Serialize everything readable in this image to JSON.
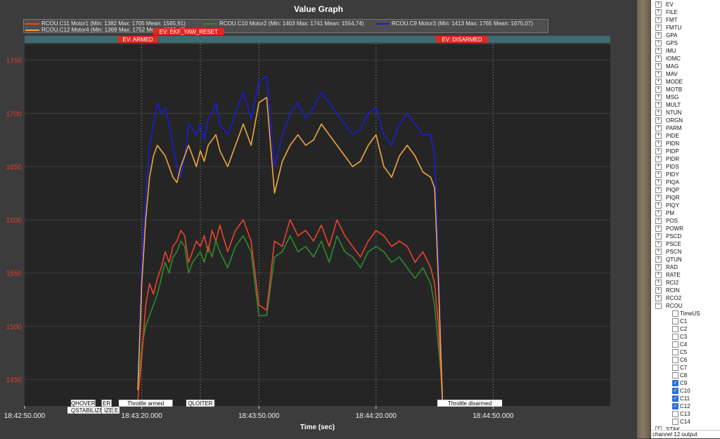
{
  "graph": {
    "title": "Value Graph",
    "xlabel": "Time (sec)"
  },
  "legend": [
    {
      "label": "RCOU.C11 Motor1 (Min: 1382 Max: 1705 Mean: 1565,91)",
      "color": "#e8452c"
    },
    {
      "label": "RCOU.C10 Motor2 (Min: 1403 Max: 1741 Mean: 1554,74)",
      "color": "#2e8b2e"
    },
    {
      "label": "RCOU.C9 Motor3 (Min: 1413 Max: 1765 Mean: 1675,07)",
      "color": "#1c1cdc"
    },
    {
      "label": "RCOU.C12 Motor4 (Min: 1369 Max: 1752 Mean: 1666,43)",
      "color": "#f0a640"
    }
  ],
  "event_labels": [
    {
      "text": "EV: ARMED",
      "t": 29
    },
    {
      "text": "EV: EKF_YAW_RESET",
      "t": 42
    },
    {
      "text": "EV: DISARMED",
      "t": 112
    }
  ],
  "mode_labels": [
    {
      "text": "QHOVER",
      "t": 15,
      "row": 0
    },
    {
      "text": "ER",
      "t": 21,
      "row": 0
    },
    {
      "text": "QSTABILIZE",
      "t": 16,
      "row": 1
    },
    {
      "text": "IZE",
      "t": 21.5,
      "row": 1
    },
    {
      "text": "E",
      "t": 23.5,
      "row": 1
    },
    {
      "text": "Throttle armed",
      "t": 31,
      "row": 0
    },
    {
      "text": "QLOITER",
      "t": 45,
      "row": 0
    },
    {
      "text": "Throttle disarmed",
      "t": 114,
      "row": 0
    }
  ],
  "colors": {
    "plot_bg": "#252525",
    "event_red": "#e0281e",
    "strip": "#3e6b72"
  },
  "chart_data": {
    "type": "line",
    "title": "Value Graph",
    "xlabel": "Time (sec)",
    "ylabel": "",
    "x_unit": "seconds since 18:42:50",
    "xlim": [
      0,
      150
    ],
    "ylim": [
      1425,
      1765
    ],
    "x_ticks": [
      {
        "t": 0,
        "label": "18:42:50.000"
      },
      {
        "t": 30,
        "label": "18:43:20.000"
      },
      {
        "t": 60,
        "label": "18:43:50.000"
      },
      {
        "t": 90,
        "label": "18:44:20.000"
      },
      {
        "t": 120,
        "label": "18:44:50.000"
      }
    ],
    "y_ticks": [
      1450,
      1500,
      1550,
      1600,
      1650,
      1700,
      1750
    ],
    "grid": true,
    "vertical_markers": [
      30,
      45,
      60,
      90,
      120
    ],
    "series": [
      {
        "name": "RCOU.C11 Motor1",
        "color": "#e8452c",
        "x": [
          29,
          30,
          31,
          32,
          33,
          34,
          35,
          36,
          37,
          38,
          39,
          40,
          41,
          42,
          43,
          44,
          45,
          46,
          47,
          48,
          49,
          50,
          52,
          54,
          56,
          58,
          60,
          62,
          64,
          66,
          68,
          70,
          72,
          74,
          76,
          78,
          80,
          82,
          84,
          86,
          88,
          90,
          92,
          94,
          96,
          98,
          100,
          102,
          104,
          105,
          106,
          107
        ],
        "y": [
          1430,
          1470,
          1520,
          1540,
          1530,
          1545,
          1555,
          1570,
          1560,
          1575,
          1580,
          1590,
          1585,
          1560,
          1570,
          1580,
          1575,
          1585,
          1570,
          1590,
          1580,
          1595,
          1570,
          1590,
          1600,
          1580,
          1520,
          1515,
          1580,
          1575,
          1600,
          1585,
          1590,
          1580,
          1595,
          1575,
          1600,
          1585,
          1575,
          1565,
          1580,
          1590,
          1585,
          1575,
          1580,
          1575,
          1560,
          1570,
          1555,
          1540,
          1500,
          1430
        ]
      },
      {
        "name": "RCOU.C10 Motor2",
        "color": "#2e8b2e",
        "x": [
          29,
          30,
          31,
          32,
          33,
          34,
          35,
          36,
          37,
          38,
          39,
          40,
          41,
          42,
          43,
          44,
          45,
          46,
          47,
          48,
          49,
          50,
          52,
          54,
          56,
          58,
          60,
          62,
          64,
          66,
          68,
          70,
          72,
          74,
          76,
          78,
          80,
          82,
          84,
          86,
          88,
          90,
          92,
          94,
          96,
          98,
          100,
          102,
          104,
          105,
          106,
          107
        ],
        "y": [
          1440,
          1480,
          1500,
          1510,
          1520,
          1530,
          1545,
          1560,
          1550,
          1565,
          1570,
          1580,
          1575,
          1550,
          1560,
          1565,
          1570,
          1560,
          1575,
          1565,
          1580,
          1570,
          1555,
          1575,
          1585,
          1570,
          1510,
          1510,
          1565,
          1570,
          1585,
          1570,
          1575,
          1565,
          1580,
          1560,
          1585,
          1570,
          1565,
          1555,
          1570,
          1575,
          1570,
          1560,
          1565,
          1555,
          1545,
          1555,
          1540,
          1520,
          1480,
          1440
        ]
      },
      {
        "name": "RCOU.C9 Motor3",
        "color": "#1c1cdc",
        "x": [
          29,
          30,
          31,
          32,
          33,
          34,
          35,
          36,
          37,
          38,
          39,
          40,
          41,
          42,
          43,
          44,
          45,
          46,
          47,
          48,
          49,
          50,
          52,
          54,
          56,
          58,
          60,
          62,
          64,
          66,
          68,
          70,
          72,
          74,
          76,
          78,
          80,
          82,
          84,
          86,
          88,
          90,
          92,
          94,
          96,
          98,
          100,
          102,
          104,
          105,
          106,
          107
        ],
        "y": [
          1450,
          1560,
          1620,
          1670,
          1690,
          1710,
          1700,
          1705,
          1690,
          1670,
          1650,
          1640,
          1660,
          1690,
          1685,
          1680,
          1690,
          1675,
          1695,
          1700,
          1710,
          1690,
          1680,
          1700,
          1720,
          1695,
          1730,
          1735,
          1650,
          1680,
          1700,
          1710,
          1695,
          1705,
          1720,
          1710,
          1700,
          1690,
          1680,
          1685,
          1700,
          1705,
          1680,
          1670,
          1690,
          1700,
          1690,
          1680,
          1680,
          1660,
          1560,
          1430
        ]
      },
      {
        "name": "RCOU.C12 Motor4",
        "color": "#f0a640",
        "x": [
          29,
          30,
          31,
          32,
          33,
          34,
          35,
          36,
          37,
          38,
          39,
          40,
          41,
          42,
          43,
          44,
          45,
          46,
          47,
          48,
          49,
          50,
          52,
          54,
          56,
          58,
          60,
          62,
          64,
          66,
          68,
          70,
          72,
          74,
          76,
          78,
          80,
          82,
          84,
          86,
          88,
          90,
          92,
          94,
          96,
          98,
          100,
          102,
          104,
          105,
          106,
          107
        ],
        "y": [
          1440,
          1540,
          1600,
          1640,
          1660,
          1670,
          1665,
          1660,
          1650,
          1640,
          1635,
          1650,
          1660,
          1670,
          1660,
          1650,
          1665,
          1655,
          1670,
          1675,
          1680,
          1665,
          1650,
          1670,
          1690,
          1670,
          1710,
          1715,
          1625,
          1655,
          1670,
          1680,
          1670,
          1675,
          1690,
          1680,
          1670,
          1660,
          1650,
          1655,
          1670,
          1680,
          1650,
          1640,
          1660,
          1670,
          1660,
          1645,
          1640,
          1630,
          1540,
          1430
        ]
      }
    ]
  },
  "tree": {
    "items": [
      "EV",
      "FILE",
      "FMT",
      "FMTU",
      "GPA",
      "GPS",
      "IMU",
      "IOMC",
      "MAG",
      "MAV",
      "MODE",
      "MOTB",
      "MSG",
      "MULT",
      "NTUN",
      "ORGN",
      "PARM",
      "PIDE",
      "PIDN",
      "PIDP",
      "PIDR",
      "PIDS",
      "PIDY",
      "PIQA",
      "PIQP",
      "PIQR",
      "PIQY",
      "PM",
      "POS",
      "POWR",
      "PSCD",
      "PSCE",
      "PSCN",
      "QTUN",
      "RAD",
      "RATE",
      "RCI2",
      "RCIN",
      "RCO2",
      "RCOU"
    ],
    "rcou_children": [
      {
        "label": "TimeUS",
        "checked": false
      },
      {
        "label": "C1",
        "checked": false
      },
      {
        "label": "C2",
        "checked": false
      },
      {
        "label": "C3",
        "checked": false
      },
      {
        "label": "C4",
        "checked": false
      },
      {
        "label": "C5",
        "checked": false
      },
      {
        "label": "C6",
        "checked": false
      },
      {
        "label": "C7",
        "checked": false
      },
      {
        "label": "C8",
        "checked": false
      },
      {
        "label": "C9",
        "checked": true
      },
      {
        "label": "C10",
        "checked": true
      },
      {
        "label": "C11",
        "checked": true
      },
      {
        "label": "C12",
        "checked": true
      },
      {
        "label": "C13",
        "checked": false
      },
      {
        "label": "C14",
        "checked": false
      }
    ],
    "after": [
      "STAK"
    ],
    "status": "channel 12 output"
  }
}
